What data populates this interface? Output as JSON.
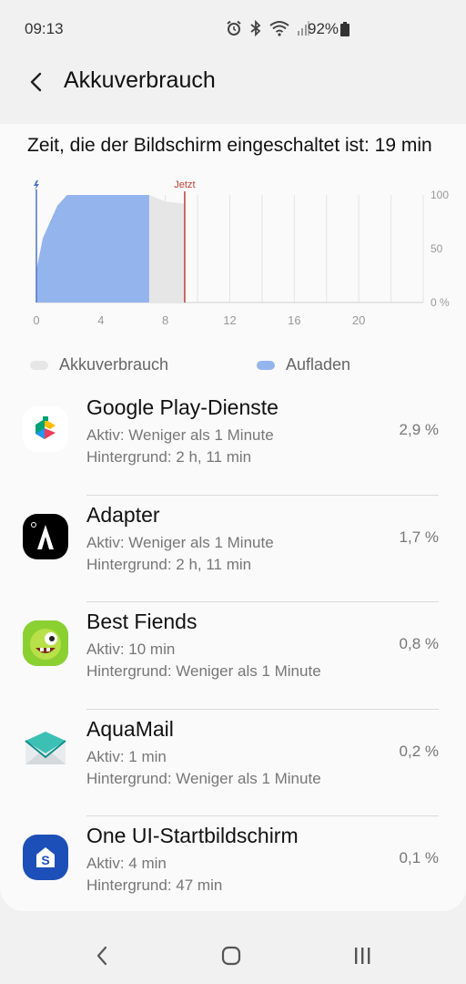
{
  "status": {
    "time": "09:13",
    "battery": "92%",
    "icons": [
      "alarm-icon",
      "bluetooth-icon",
      "wifi-icon",
      "signal-icon",
      "battery-icon"
    ]
  },
  "header": {
    "back_icon": "arrow-left-icon",
    "title": "Akkuverbrauch"
  },
  "screen_time": "Zeit, die der Bildschirm eingeschaltet ist: 19 min",
  "chart_data": {
    "type": "area",
    "xlabel": "",
    "ylabel": "",
    "x_ticks": [
      "0",
      "4",
      "8",
      "12",
      "16",
      "20"
    ],
    "y_ticks": [
      "100",
      "50",
      "0 %"
    ],
    "xlim": [
      0,
      24
    ],
    "ylim": [
      0,
      100
    ],
    "now_marker": {
      "label": "Jetzt",
      "x": 9.2,
      "color": "#c0403a"
    },
    "charging_icon": "lightning-icon",
    "series": [
      {
        "name": "Aufladen",
        "color": "#94b4ed",
        "x": [
          0,
          0.4,
          1.3,
          1.9,
          7.0
        ],
        "y": [
          30,
          60,
          90,
          100,
          100
        ]
      },
      {
        "name": "Akkuverbrauch",
        "color": "#e6e6e6",
        "x": [
          7.0,
          8.0,
          9.2
        ],
        "y": [
          100,
          94,
          92
        ]
      }
    ]
  },
  "legend": [
    {
      "label": "Akkuverbrauch",
      "color": "#e6e6e6"
    },
    {
      "label": "Aufladen",
      "color": "#94b4ed"
    }
  ],
  "apps": [
    {
      "name": "Google Play-Dienste",
      "active": "Aktiv: Weniger als 1 Minute",
      "background": "Hintergrund: 2 h, 11 min",
      "percent": "2,9 %",
      "icon": "google-play-services-icon"
    },
    {
      "name": "Adapter",
      "active": "Aktiv: Weniger als 1 Minute",
      "background": "Hintergrund: 2 h, 11 min",
      "percent": "1,7 %",
      "icon": "adapter-icon"
    },
    {
      "name": "Best Fiends",
      "active": "Aktiv: 10 min",
      "background": "Hintergrund: Weniger als 1 Minute",
      "percent": "0,8 %",
      "icon": "best-fiends-icon"
    },
    {
      "name": "AquaMail",
      "active": "Aktiv: 1 min",
      "background": "Hintergrund: Weniger als 1 Minute",
      "percent": "0,2 %",
      "icon": "aquamail-icon"
    },
    {
      "name": "One UI-Startbildschirm",
      "active": "Aktiv: 4 min",
      "background": "Hintergrund: 47 min",
      "percent": "0,1 %",
      "icon": "one-ui-home-icon"
    }
  ],
  "nav": {
    "back_icon": "back-icon",
    "home_icon": "home-icon",
    "recents_icon": "recents-icon"
  }
}
